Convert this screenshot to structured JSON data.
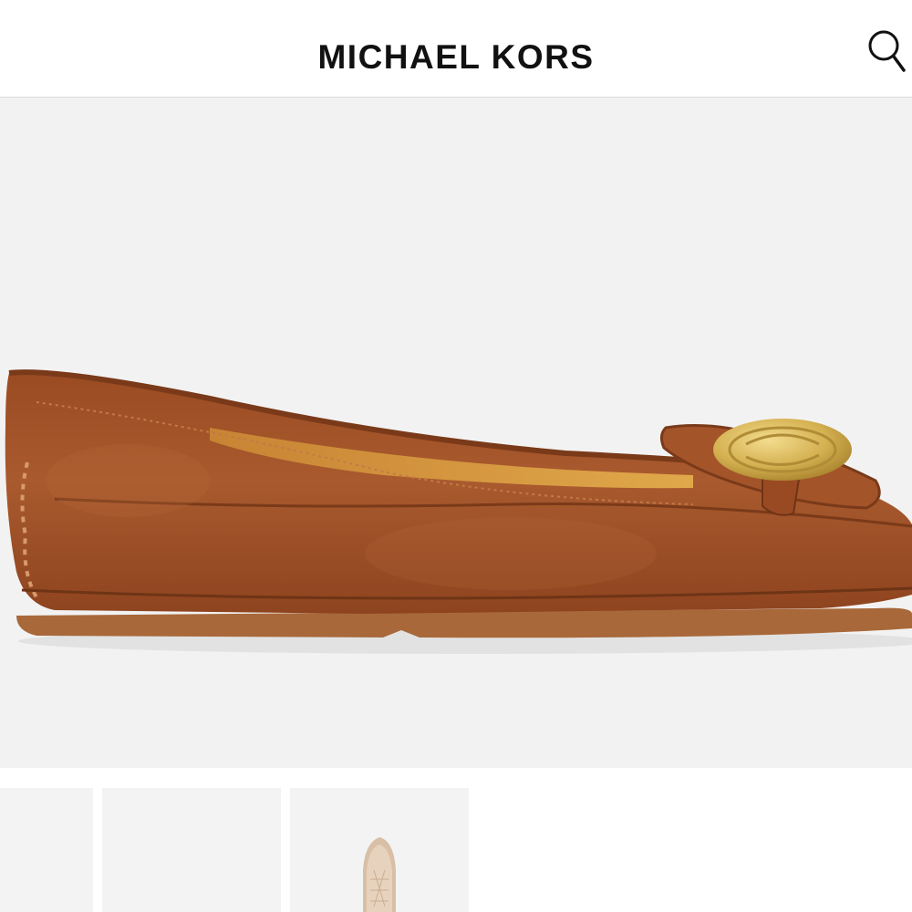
{
  "header": {
    "brand": "MICHAEL KORS",
    "search_icon": "search-icon"
  },
  "product": {
    "image": "brown-leather-flat-shoe",
    "colors": {
      "leather": "#a5542a",
      "lining": "#d79a3e",
      "hardware": "#d6b55a",
      "background": "#f2f2f2"
    }
  },
  "thumbnails": [
    {
      "name": "thumbnail-1"
    },
    {
      "name": "thumbnail-2"
    },
    {
      "name": "thumbnail-3"
    }
  ]
}
